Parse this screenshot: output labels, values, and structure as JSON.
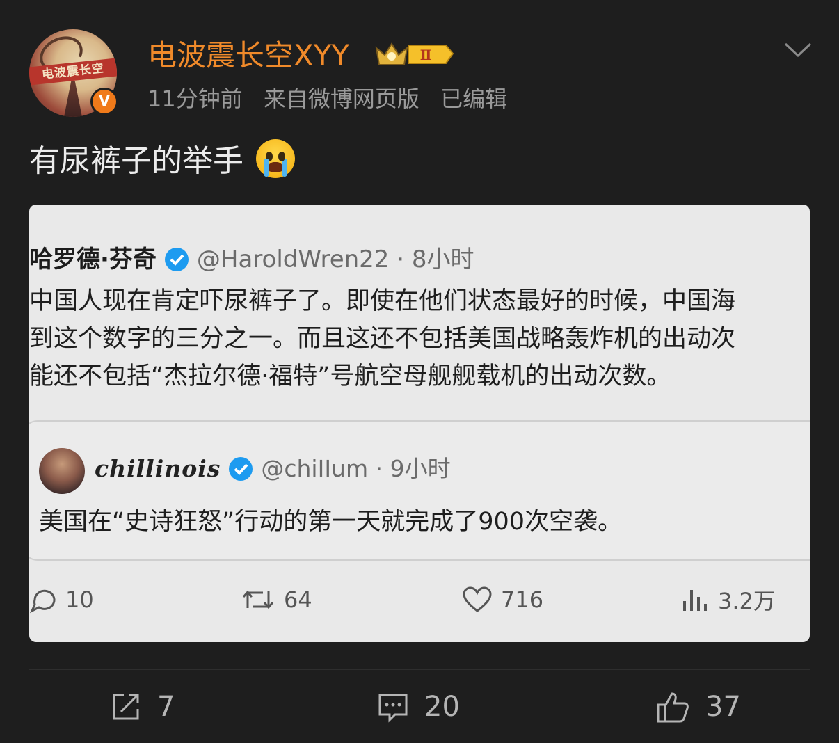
{
  "post": {
    "author": {
      "name": "电波震长空XYY",
      "avatar_text": "电波震长空",
      "verified_badge": "V",
      "level_badge": "Ⅱ"
    },
    "meta": {
      "time": "11分钟前",
      "source": "来自微博网页版",
      "edited": "已编辑"
    },
    "text": "有尿裤子的举手",
    "emoji": "crying-face-icon"
  },
  "embedded_tweet": {
    "name": "哈罗德·芬奇",
    "handle": "@HaroldWren22",
    "time": "· 8小时",
    "body_lines": [
      "中国人现在肯定吓尿裤子了。即使在他们状态最好的时候，中国海",
      "到这个数字的三分之一。而且这还不包括美国战略轰炸机的出动次",
      "能还不包括“杰拉尔德·福特”号航空母舰舰载机的出动次数。"
    ],
    "quote": {
      "name": "chillinois",
      "handle": "@chiIIum",
      "time": "· 9小时",
      "body": "美国在“史诗狂怒”行动的第一天就完成了900次空袭。"
    },
    "stats": {
      "replies": "10",
      "retweets": "64",
      "likes": "716",
      "views": "3.2万"
    }
  },
  "actions": {
    "repost_count": "7",
    "comment_count": "20",
    "like_count": "37"
  },
  "colors": {
    "background": "#1e1e1e",
    "username": "#f08a2a",
    "meta_text": "#9a9a9a",
    "verified_orange": "#f07a1a",
    "twitter_blue": "#1d9bf0"
  }
}
